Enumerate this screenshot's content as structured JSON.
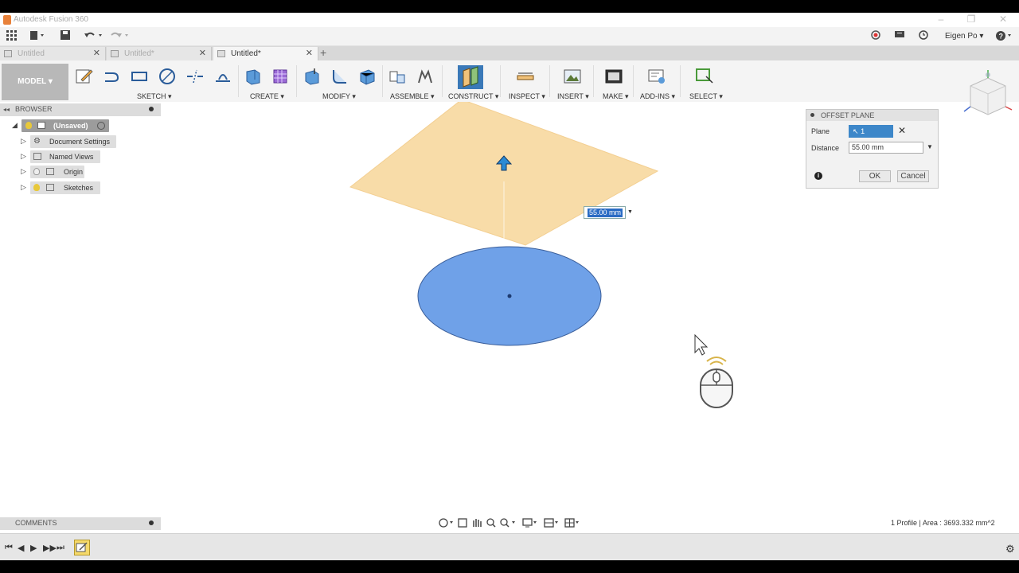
{
  "window": {
    "title": "Autodesk Fusion 360"
  },
  "quick_access": {
    "user_name": "Eigen Po",
    "icons": [
      "grid-icon",
      "file-icon",
      "save-icon",
      "undo-icon",
      "redo-icon",
      "record-icon",
      "chat-icon",
      "clock-icon",
      "help-icon"
    ]
  },
  "tabs": [
    {
      "label": "Untitled",
      "active": false
    },
    {
      "label": "Untitled*",
      "active": false
    },
    {
      "label": "Untitled*",
      "active": true
    }
  ],
  "ribbon": {
    "workspace": "MODEL",
    "groups": [
      "SKETCH",
      "CREATE",
      "MODIFY",
      "ASSEMBLE",
      "CONSTRUCT",
      "INSPECT",
      "INSERT",
      "MAKE",
      "ADD-INS",
      "SELECT"
    ]
  },
  "browser": {
    "title": "BROWSER",
    "root": "(Unsaved)",
    "items": [
      "Document Settings",
      "Named Views",
      "Origin",
      "Sketches"
    ]
  },
  "comments": {
    "title": "COMMENTS"
  },
  "dialog": {
    "title": "OFFSET PLANE",
    "plane_label": "Plane",
    "plane_value": "1 selected",
    "distance_label": "Distance",
    "distance_value": "55.00 mm",
    "ok_label": "OK",
    "cancel_label": "Cancel"
  },
  "canvas": {
    "inline_distance": "55.00 mm"
  },
  "status": {
    "text": "1 Profile | Area : 3693.332 mm^2"
  },
  "colors": {
    "plane_fill": "#f8dca8",
    "profile_fill": "#6fa1e8",
    "accent_blue": "#3d87c9",
    "ribbon_bg": "#f4f4f4"
  }
}
